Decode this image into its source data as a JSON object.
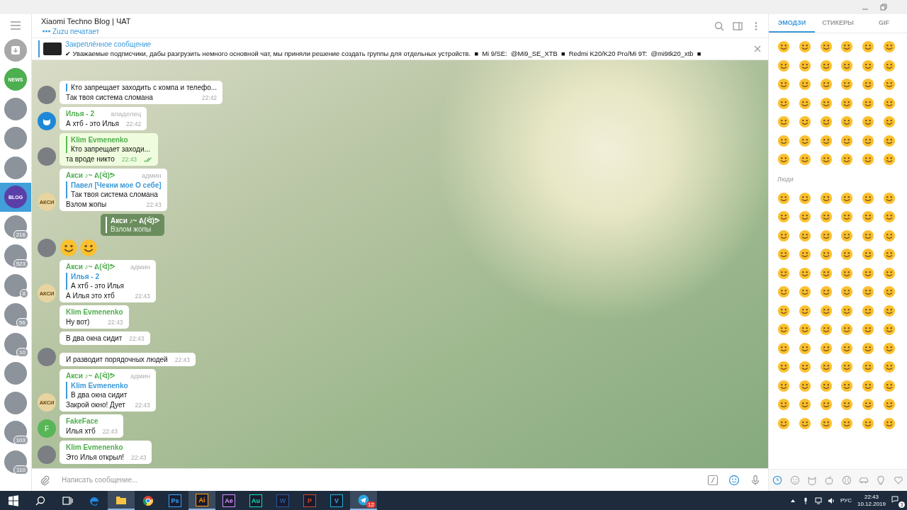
{
  "sidebar": {
    "items": [
      {
        "kind": "archive",
        "selected": false
      },
      {
        "kind": "logo",
        "label": "NEWS",
        "color": "#4caf50",
        "selected": false
      },
      {
        "kind": "photo",
        "selected": false
      },
      {
        "kind": "photo",
        "selected": false
      },
      {
        "kind": "photo",
        "selected": false
      },
      {
        "kind": "logo",
        "label": "BLOG",
        "color": "#5b3fa8",
        "selected": true
      },
      {
        "kind": "photo",
        "badge": "216",
        "selected": false
      },
      {
        "kind": "photo",
        "badge": "523",
        "selected": false
      },
      {
        "kind": "photo",
        "badge": "8",
        "selected": false
      },
      {
        "kind": "photo",
        "badge": "56",
        "selected": false
      },
      {
        "kind": "photo",
        "badge": "10",
        "selected": false
      },
      {
        "kind": "photo",
        "selected": false
      },
      {
        "kind": "photo",
        "selected": false
      },
      {
        "kind": "photo",
        "badge": "103",
        "selected": false
      },
      {
        "kind": "photo",
        "badge": "110",
        "selected": false
      }
    ]
  },
  "chat": {
    "title": "Xiaomi Techno Blog | ЧАТ",
    "status": "Zuzu печатает"
  },
  "pinned": {
    "label": "Закреплённое сообщение",
    "text": "✔ Уважаемые подписчики, дабы разгрузить немного основной чат, мы приняли решение создать группы для отдельных устройств.  ■  Mi 9/SE:  @Mi9_SE_XTB  ■  Redmi K20/K20 Pro/Mi 9T:  @mi9tk20_xtb  ■"
  },
  "messages": [
    {
      "kind": "text",
      "avatar": {
        "kind": "photo"
      },
      "reply": {
        "text": "Кто запрещает заходить с компа и телефо..."
      },
      "text": "Так твоя система сломана",
      "time": "22:42",
      "own": false
    },
    {
      "kind": "text",
      "avatar": {
        "kind": "icon"
      },
      "sender": "Илья - 2",
      "role": "владелец",
      "text": "А хтб - это Илья",
      "time": "22:42",
      "own": false
    },
    {
      "kind": "text",
      "avatar": {
        "kind": "photo"
      },
      "reply": {
        "name": "Klim Evmenenko",
        "text": "Кто запрещает заходи..."
      },
      "text": "та вроде никто",
      "time": "22:43",
      "own": true,
      "read": true
    },
    {
      "kind": "text",
      "avatar": {
        "kind": "doge",
        "label": "АКСИ"
      },
      "sender": "Акси ♪~ ᕕ(ᐛ)ᕗ",
      "role": "админ",
      "reply": {
        "name": "Павел [Чекни мое О себе]",
        "text": "Так твоя система сломана"
      },
      "text": "Взлом жопы",
      "time": "22:43",
      "own": false
    },
    {
      "kind": "emoji",
      "avatar": {
        "kind": "photo"
      },
      "reply": {
        "name": "Акси ♪~ ᕕ(ᐛ)ᕗ",
        "text": "Взлом жопы"
      }
    },
    {
      "kind": "text",
      "avatar": {
        "kind": "doge",
        "label": "АКСИ"
      },
      "sender": "Акси ♪~ ᕕ(ᐛ)ᕗ",
      "role": "админ",
      "reply": {
        "name": "Илья - 2",
        "text": "А хтб - это Илья"
      },
      "text": "А Илья это хтб",
      "time": "22:43",
      "own": false
    },
    {
      "kind": "text",
      "sender": "Klim Evmenenko",
      "text": "Ну вот)",
      "time": "22:43",
      "own": false
    },
    {
      "kind": "text",
      "text": "В два окна сидит",
      "time": "22:43",
      "own": false
    },
    {
      "kind": "text",
      "avatar": {
        "kind": "photo"
      },
      "text": "И разводит порядочных людей",
      "time": "22:43",
      "own": false
    },
    {
      "kind": "text",
      "avatar": {
        "kind": "doge",
        "label": "АКСИ"
      },
      "sender": "Акси ♪~ ᕕ(ᐛ)ᕗ",
      "role": "админ",
      "reply": {
        "name": "Klim Evmenenko",
        "text": "В два окна сидит"
      },
      "text": "Закрой окно! Дует",
      "time": "22:43",
      "own": false
    },
    {
      "kind": "text",
      "avatar": {
        "kind": "letter",
        "label": "F"
      },
      "sender": "FakeFace",
      "text": "Илья хтб",
      "time": "22:43",
      "own": false
    },
    {
      "kind": "text",
      "avatar": {
        "kind": "photo"
      },
      "sender": "Klim Evmenenko",
      "text": "Это Илья открыл!",
      "time": "22:43",
      "own": false
    }
  ],
  "composer": {
    "placeholder": "Написать сообщение..."
  },
  "emoji_panel": {
    "tabs": [
      {
        "label": "ЭМОДЗИ",
        "selected": true
      },
      {
        "label": "СТИКЕРЫ",
        "selected": false
      },
      {
        "label": "GIF",
        "selected": false
      }
    ],
    "section": "Люди",
    "categories": [
      {
        "kind": "recent",
        "selected": true
      },
      {
        "kind": "smiley",
        "selected": false
      },
      {
        "kind": "cat",
        "selected": false
      },
      {
        "kind": "apple",
        "selected": false
      },
      {
        "kind": "ball",
        "selected": false
      },
      {
        "kind": "car",
        "selected": false
      },
      {
        "kind": "bulb",
        "selected": false
      },
      {
        "kind": "heart",
        "selected": false
      }
    ]
  },
  "taskbar": {
    "apps": [
      {
        "kind": "edge",
        "active": false
      },
      {
        "kind": "folder",
        "active": true
      },
      {
        "kind": "chrome",
        "active": false
      },
      {
        "kind": "letter",
        "label": "Ps",
        "color": "#31a8ff",
        "active": false
      },
      {
        "kind": "letter",
        "label": "Ai",
        "color": "#ff9a00",
        "active": true
      },
      {
        "kind": "letter",
        "label": "Ae",
        "color": "#d291ff",
        "active": false
      },
      {
        "kind": "letter",
        "label": "Au",
        "color": "#00e4bb",
        "active": false
      },
      {
        "kind": "letter",
        "label": "W",
        "color": "#2b579a",
        "active": false
      },
      {
        "kind": "letter",
        "label": "P",
        "color": "#d24726",
        "active": false
      },
      {
        "kind": "letter",
        "label": "V",
        "color": "#1fb2d8",
        "active": false
      },
      {
        "kind": "telegram",
        "badge": "12",
        "active": true
      }
    ],
    "tray": {
      "language": "РУС",
      "time": "22:43",
      "date": "10.12.2019",
      "notifications": "3"
    }
  }
}
